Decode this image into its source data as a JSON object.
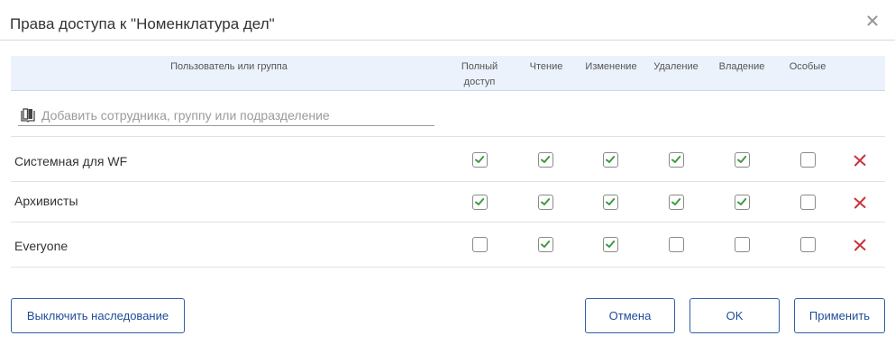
{
  "dialog": {
    "title": "Права доступа к \"Номенклатура дел\""
  },
  "table": {
    "headers": {
      "user_or_group": "Пользователь или группа",
      "full_access_line1": "Полный",
      "full_access_line2": "доступ",
      "read": "Чтение",
      "modify": "Изменение",
      "delete": "Удаление",
      "ownership": "Владение",
      "special": "Особые"
    },
    "add_placeholder": "Добавить сотрудника, группу или подразделение",
    "rows": [
      {
        "label": "Системная для WF",
        "full": true,
        "read": true,
        "modify": true,
        "delete": true,
        "own": true,
        "special": false
      },
      {
        "label": "Архивисты",
        "full": true,
        "read": true,
        "modify": true,
        "delete": true,
        "own": true,
        "special": false
      },
      {
        "label": "Everyone",
        "full": false,
        "read": true,
        "modify": true,
        "delete": false,
        "own": false,
        "special": false
      }
    ]
  },
  "buttons": {
    "disable_inheritance": "Выключить наследование",
    "cancel": "Отмена",
    "ok": "OK",
    "apply": "Применить"
  },
  "icons": {
    "close": "close-icon",
    "address_book": "address-book-icon",
    "delete": "delete-icon",
    "check": "check-icon"
  },
  "colors": {
    "header_bg": "#ebf2fc",
    "check": "#3d9a3d",
    "delete": "#c8333a",
    "button_border": "#2f5fa8",
    "button_text": "#1f4c99"
  }
}
